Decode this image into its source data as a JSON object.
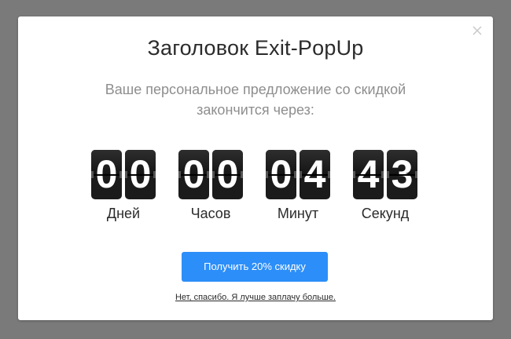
{
  "popup": {
    "title": "Заголовок Exit-PopUp",
    "subtitle_line1": "Ваше персональное предложение со скидкой",
    "subtitle_line2": "закончится через:",
    "close_icon": "close-icon"
  },
  "timer": {
    "units": [
      {
        "digits": [
          "0",
          "0"
        ],
        "label": "Дней"
      },
      {
        "digits": [
          "0",
          "0"
        ],
        "label": "Часов"
      },
      {
        "digits": [
          "0",
          "4"
        ],
        "label": "Минут"
      },
      {
        "digits": [
          "4",
          "3"
        ],
        "label": "Секунд"
      }
    ]
  },
  "cta": {
    "label": "Получить 20% скидку"
  },
  "decline": {
    "label": "Нет, спасибо. Я лучше заплачу больше."
  },
  "colors": {
    "overlay": "#7a7a7a",
    "popup_bg": "#ffffff",
    "digit_bg": "#1b1b1b",
    "cta_bg": "#2c8ef8",
    "subtitle_text": "#8e8e8e"
  }
}
